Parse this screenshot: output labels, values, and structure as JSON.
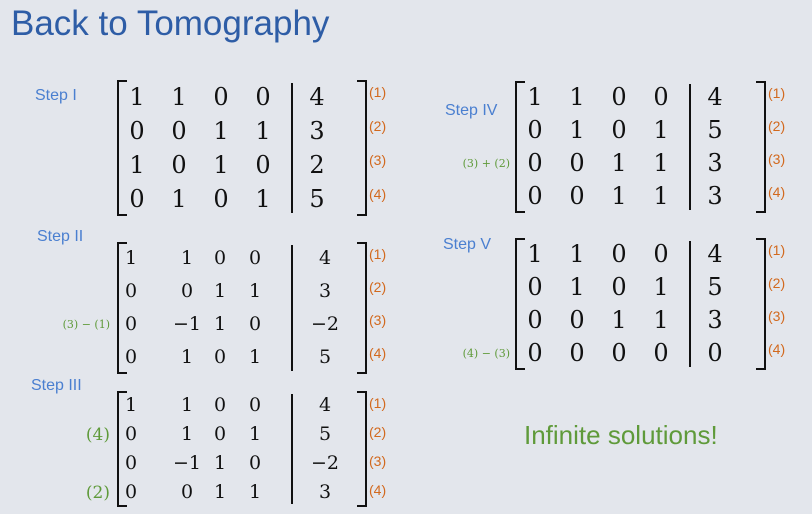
{
  "title": "Back to Tomography",
  "conclusion": "Infinite solutions!",
  "steps": {
    "s1": {
      "label": "Step I",
      "rows": [
        [
          "1",
          "1",
          "0",
          "0",
          "4"
        ],
        [
          "0",
          "0",
          "1",
          "1",
          "3"
        ],
        [
          "1",
          "0",
          "1",
          "0",
          "2"
        ],
        [
          "0",
          "1",
          "0",
          "1",
          "5"
        ]
      ],
      "row_labels": [
        "(1)",
        "(2)",
        "(3)",
        "(4)"
      ],
      "ops": []
    },
    "s2": {
      "label": "Step II",
      "rows": [
        [
          "1",
          "1",
          "0",
          "0",
          "4"
        ],
        [
          "0",
          "0",
          "1",
          "1",
          "3"
        ],
        [
          "0",
          "−1",
          "1",
          "0",
          "−2"
        ],
        [
          "0",
          "1",
          "0",
          "1",
          "5"
        ]
      ],
      "row_labels": [
        "(1)",
        "(2)",
        "(3)",
        "(4)"
      ],
      "ops": [
        "",
        "",
        "(3) − (1)",
        ""
      ]
    },
    "s3": {
      "label": "Step III",
      "rows": [
        [
          "1",
          "1",
          "0",
          "0",
          "4"
        ],
        [
          "0",
          "1",
          "0",
          "1",
          "5"
        ],
        [
          "0",
          "−1",
          "1",
          "0",
          "−2"
        ],
        [
          "0",
          "0",
          "1",
          "1",
          "3"
        ]
      ],
      "row_labels": [
        "(1)",
        "(2)",
        "(3)",
        "(4)"
      ],
      "ops": [
        "",
        "(4)",
        "",
        "(2)"
      ]
    },
    "s4": {
      "label": "Step IV",
      "rows": [
        [
          "1",
          "1",
          "0",
          "0",
          "4"
        ],
        [
          "0",
          "1",
          "0",
          "1",
          "5"
        ],
        [
          "0",
          "0",
          "1",
          "1",
          "3"
        ],
        [
          "0",
          "0",
          "1",
          "1",
          "3"
        ]
      ],
      "row_labels": [
        "(1)",
        "(2)",
        "(3)",
        "(4)"
      ],
      "ops": [
        "",
        "",
        "(3) + (2)",
        ""
      ]
    },
    "s5": {
      "label": "Step V",
      "rows": [
        [
          "1",
          "1",
          "0",
          "0",
          "4"
        ],
        [
          "0",
          "1",
          "0",
          "1",
          "5"
        ],
        [
          "0",
          "0",
          "1",
          "1",
          "3"
        ],
        [
          "0",
          "0",
          "0",
          "0",
          "0"
        ]
      ],
      "row_labels": [
        "(1)",
        "(2)",
        "(3)",
        "(4)"
      ],
      "ops": [
        "",
        "",
        "",
        "(4) − (3)"
      ]
    }
  },
  "colors": {
    "title": "#2e5da6",
    "step_label": "#4a7fd0",
    "operation": "#5f9a3a",
    "row_label": "#d2691e",
    "background": "#e3e6ec"
  }
}
